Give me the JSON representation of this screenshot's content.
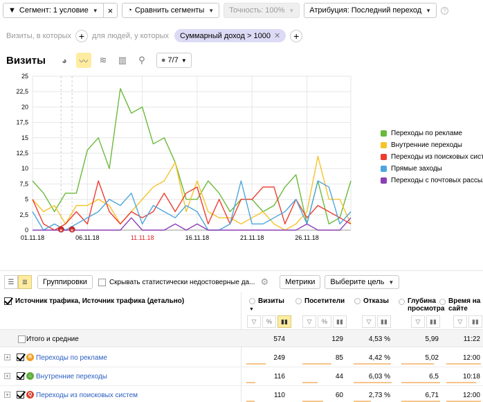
{
  "toolbar": {
    "segment_label": "Сегмент: 1 условие",
    "compare_label": "Сравнить сегменты",
    "accuracy_label": "Точность: 100%",
    "attribution_label": "Атрибуция: Последний переход"
  },
  "filter_row": {
    "visits_where": "Визиты, в которых",
    "people_where": "для людей, у которых",
    "chip_label": "Суммарный доход > 1000"
  },
  "graph_header": {
    "title": "Визиты",
    "counter_label": "7/7"
  },
  "chart_data": {
    "type": "line",
    "x": [
      "01.11.18",
      "02.11.18",
      "03.11.18",
      "04.11.18",
      "05.11.18",
      "06.11.18",
      "07.11.18",
      "08.11.18",
      "09.11.18",
      "10.11.18",
      "11.11.18",
      "12.11.18",
      "13.11.18",
      "14.11.18",
      "15.11.18",
      "16.11.18",
      "17.11.18",
      "18.11.18",
      "19.11.18",
      "20.11.18",
      "21.11.18",
      "22.11.18",
      "23.11.18",
      "24.11.18",
      "25.11.18",
      "26.11.18",
      "27.11.18",
      "28.11.18",
      "29.11.18",
      "30.11.18"
    ],
    "x_tick_labels": [
      "01.11.18",
      "06.11.18",
      "11.11.18",
      "16.11.18",
      "21.11.18",
      "26.11.18"
    ],
    "x_tick_indices": [
      0,
      5,
      10,
      15,
      20,
      25
    ],
    "highlight_tick": "11.11.18",
    "ylim": [
      0,
      25
    ],
    "y_ticks": [
      "0",
      "2,5",
      "5",
      "7,5",
      "10",
      "12,5",
      "15",
      "17,5",
      "20",
      "22,5",
      "25"
    ],
    "grid": true,
    "legend_position": "right",
    "series": [
      {
        "name": "Переходы по рекламе",
        "color": "#6ab93a",
        "values": [
          8,
          6,
          3,
          6,
          6,
          13,
          15,
          10,
          23,
          19,
          20,
          14,
          15,
          11,
          5,
          5,
          8,
          6,
          3,
          5,
          5,
          3,
          4,
          7,
          9,
          1,
          8,
          1,
          2,
          8
        ]
      },
      {
        "name": "Внутренние переходы",
        "color": "#f5c32b",
        "values": [
          5,
          3,
          4,
          1,
          4,
          4,
          5,
          4,
          1,
          3,
          5,
          7,
          8,
          11,
          3,
          8,
          3,
          2,
          2,
          1,
          2,
          3,
          1,
          0,
          1,
          3,
          12,
          5,
          5,
          1
        ]
      },
      {
        "name": "Переходы из поисковых систем",
        "color": "#ee3b2f",
        "values": [
          5,
          1,
          0,
          1,
          3,
          1,
          8,
          3,
          1,
          3,
          2,
          3,
          6,
          3,
          6,
          7,
          1,
          5,
          1,
          5,
          5,
          7,
          7,
          1,
          5,
          2,
          4,
          3,
          2,
          1
        ]
      },
      {
        "name": "Прямые заходы",
        "color": "#4ca6de",
        "values": [
          3,
          0,
          1,
          0,
          1,
          2,
          3,
          5,
          4,
          6,
          1,
          4,
          3,
          2,
          4,
          3,
          0,
          0,
          1,
          8,
          1,
          1,
          2,
          3,
          5,
          1,
          8,
          7,
          1,
          3
        ]
      },
      {
        "name": "Переходы с почтовых рассылок",
        "color": "#8c3fb5",
        "values": [
          0,
          0,
          0,
          0,
          0,
          0,
          0,
          0,
          0,
          2,
          0,
          0,
          0,
          1,
          0,
          1,
          0,
          0,
          0,
          0,
          0,
          0,
          0,
          0,
          0,
          1,
          0,
          0,
          0,
          2
        ]
      }
    ],
    "annotations": [
      "н",
      "н"
    ]
  },
  "table": {
    "grouping_label": "Группировки",
    "hide_unreliable_label": "Скрывать статистически недостоверные да...",
    "metrics_label": "Метрики",
    "goal_label": "Выберите цель",
    "dimension_header": "Источник трафика, Источник трафика (детально)",
    "columns": [
      {
        "label": "Визиты",
        "sorted": true
      },
      {
        "label": "Посетители"
      },
      {
        "label": "Отказы"
      },
      {
        "label": "Глубина просмотра"
      },
      {
        "label": "Время на сайте"
      }
    ],
    "totals": {
      "label": "Итого и средние",
      "values": [
        "574",
        "129",
        "4,53 %",
        "5,99",
        "11:22"
      ]
    },
    "rows": [
      {
        "label": "Переходы по рекламе",
        "icon": "ad-icon",
        "values": [
          "249",
          "85",
          "4,42 %",
          "5,02",
          "12:00"
        ],
        "fill": [
          0.43,
          0.66,
          0.98,
          0.84,
          1
        ]
      },
      {
        "label": "Внутренние переходы",
        "icon": "home-icon",
        "values": [
          "116",
          "44",
          "6,03 %",
          "6,5",
          "10:18"
        ],
        "fill": [
          0.2,
          0.34,
          1,
          1,
          0.86
        ]
      },
      {
        "label": "Переходы из поисковых систем",
        "icon": "search-icon",
        "values": [
          "110",
          "60",
          "2,73 %",
          "6,71",
          "12:00"
        ],
        "fill": [
          0.19,
          0.47,
          0.45,
          1,
          1
        ]
      }
    ]
  }
}
